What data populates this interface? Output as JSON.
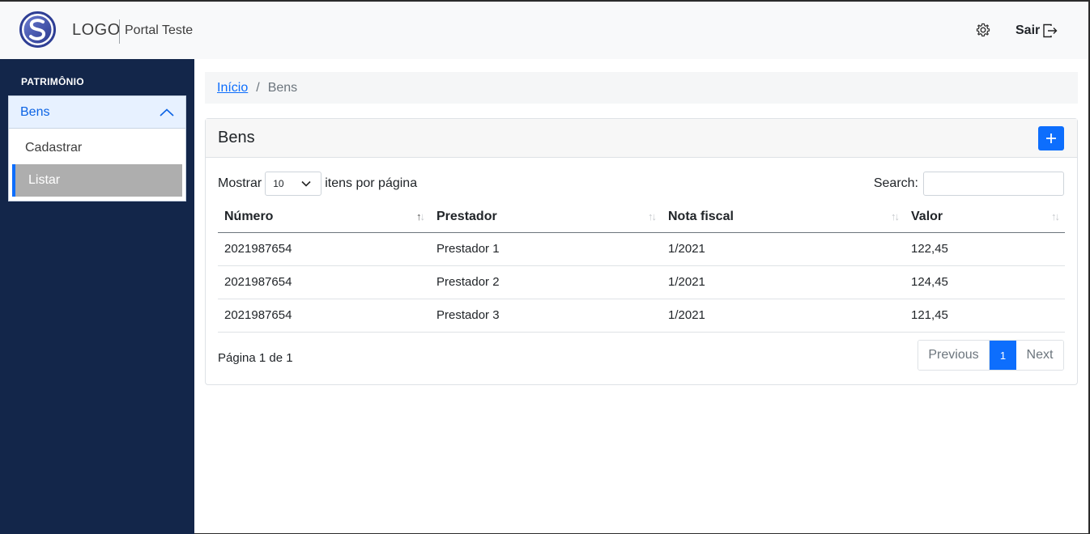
{
  "header": {
    "logo_text": "LOGO",
    "portal_title": "Portal Teste",
    "logout_label": "Sair",
    "icons": {
      "settings": "gear-icon",
      "logout": "logout-icon",
      "logo": "logo-s-icon"
    }
  },
  "sidebar": {
    "section_title": "PATRIMÔNIO",
    "group_label": "Bens",
    "items": [
      {
        "label": "Cadastrar",
        "active": false
      },
      {
        "label": "Listar",
        "active": true
      }
    ]
  },
  "breadcrumb": {
    "home": "Início",
    "separator": "/",
    "current": "Bens"
  },
  "card": {
    "title": "Bens",
    "add_label": "+"
  },
  "controls": {
    "show_label": "Mostrar",
    "page_size": "10",
    "per_page_label": "itens por página",
    "search_label": "Search:",
    "search_value": ""
  },
  "table": {
    "headers": [
      "Número",
      "Prestador",
      "Nota fiscal",
      "Valor"
    ],
    "rows": [
      [
        "2021987654",
        "Prestador 1",
        "1/2021",
        "122,45"
      ],
      [
        "2021987654",
        "Prestador 2",
        "1/2021",
        "124,45"
      ],
      [
        "2021987654",
        "Prestador 3",
        "1/2021",
        "121,45"
      ]
    ]
  },
  "footer": {
    "info": "Página 1 de 1",
    "previous": "Previous",
    "current_page": "1",
    "next": "Next"
  },
  "colors": {
    "primary": "#0d6efd",
    "sidebar_bg": "#13264a",
    "header_bg": "#f8f9fa",
    "active_item_bg": "#aeaeae"
  }
}
